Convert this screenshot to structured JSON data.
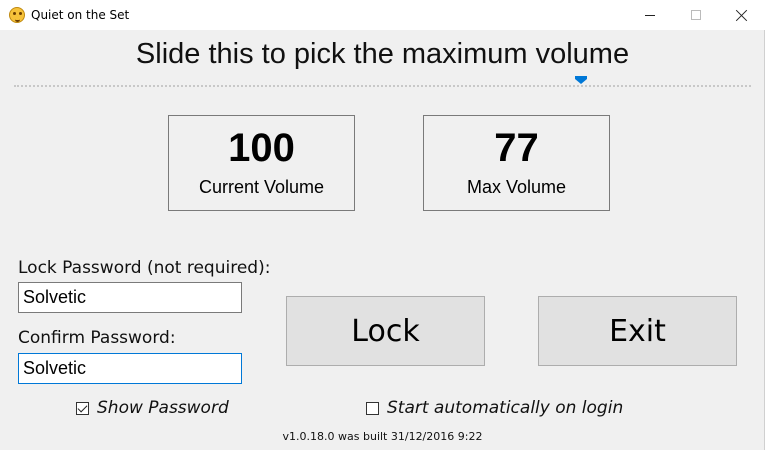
{
  "window": {
    "title": "Quiet on the Set",
    "icon": "smiley-face-icon"
  },
  "heading": "Slide this to pick the maximum volume",
  "slider": {
    "value": 77,
    "min": 0,
    "max": 100,
    "thumb_color": "#0078d7"
  },
  "current_volume": {
    "value": "100",
    "label": "Current Volume"
  },
  "max_volume": {
    "value": "77",
    "label": "Max Volume"
  },
  "lock_password": {
    "label": "Lock Password (not required):",
    "value": "Solvetic"
  },
  "confirm_password": {
    "label": "Confirm Password:",
    "value": "Solvetic"
  },
  "buttons": {
    "lock": "Lock",
    "exit": "Exit"
  },
  "checkboxes": {
    "show_password": {
      "label": "Show Password",
      "checked": true
    },
    "start_auto": {
      "label": "Start automatically on login",
      "checked": false
    }
  },
  "footer": "v1.0.18.0 was built 31/12/2016 9:22"
}
